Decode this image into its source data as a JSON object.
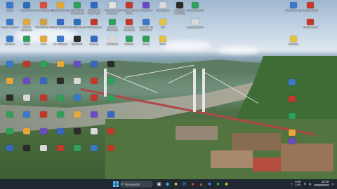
{
  "desktop": {
    "icons": [
      {
        "label": "Salvar",
        "color": "#3a78c9",
        "glyph": "folder-icon"
      },
      {
        "label": "Neyformeté",
        "color": "#2d6fb5",
        "glyph": "word-icon"
      },
      {
        "label": "Onne Scanner DI",
        "color": "#d8503c",
        "glyph": "scanner-icon"
      },
      {
        "label": "CorpsKit RoseS",
        "color": "#e4a83a",
        "glyph": "app-icon"
      },
      {
        "label": "2023 RO 2ft documentos",
        "color": "#2fa05a",
        "glyph": "folder-icon"
      },
      {
        "label": "Ativado via importação",
        "color": "#3568c0",
        "glyph": "app-icon"
      },
      {
        "label": "Winzadoraes programo",
        "color": "#e2e2e2",
        "glyph": "app-icon"
      },
      {
        "label": "PF Office-clio dei PDFs",
        "color": "#c0392b",
        "glyph": "pdf-icon"
      },
      {
        "label": "Windrafté 2",
        "color": "#6a4bc4",
        "glyph": "app-icon"
      },
      {
        "label": "PDI Arquivo",
        "color": "#d9d9d9",
        "glyph": "file-icon"
      },
      {
        "label": "Pequeño CORTES",
        "color": "#2b2b2b",
        "glyph": "app-icon"
      },
      {
        "label": "Comando BRK",
        "color": "#2fa05a",
        "glyph": "app-icon"
      },
      {
        "label": "Informe VC 1B",
        "color": "#3a78c9",
        "glyph": "app-icon"
      },
      {
        "label": "Radio CIA 20",
        "color": "#c0392b",
        "glyph": "app-icon"
      },
      {
        "label": "Gestor Outubro",
        "color": "#3a78c9",
        "glyph": "app-icon"
      },
      {
        "label": "Informe aumentos",
        "color": "#e4a83a",
        "glyph": "app-icon"
      },
      {
        "label": "TORTECAS 1B",
        "color": "#d0a040",
        "glyph": "app-icon"
      },
      {
        "label": "Ralio Acesso 2",
        "color": "#3568c0",
        "glyph": "app-icon"
      },
      {
        "label": "TC 2023 ativos",
        "color": "#2d6fb5",
        "glyph": "app-icon"
      },
      {
        "label": "ProfViewpoint",
        "color": "#c0392b",
        "glyph": "app-icon"
      },
      {
        "label": "Deveros RuntimeS",
        "color": "#2fa05a",
        "glyph": "app-icon"
      },
      {
        "label": "Consulte Solidarios",
        "color": "#c0392b",
        "glyph": "app-icon"
      },
      {
        "label": "COSAST 15 PROJETO",
        "color": "#3a78c9",
        "glyph": "app-icon"
      },
      {
        "label": "edit",
        "color": "#e4c040",
        "glyph": "folder-icon"
      },
      {
        "label": "pesquisassimo",
        "color": "#d9d9d9",
        "glyph": "file-icon"
      },
      {
        "label": "Mundo de BI",
        "color": "#c0392b",
        "glyph": "app-icon"
      },
      {
        "label": "Saldinha",
        "color": "#3a78c9",
        "glyph": "app-icon"
      },
      {
        "label": "Radio",
        "color": "#2fa05a",
        "glyph": "app-icon"
      },
      {
        "label": "Cabo",
        "color": "#e4a83a",
        "glyph": "app-icon"
      },
      {
        "label": "CF Software",
        "color": "#3a78c9",
        "glyph": "app-icon"
      },
      {
        "label": "RCORTE",
        "color": "#2b2b2b",
        "glyph": "app-icon"
      },
      {
        "label": "Informe",
        "color": "#3568c0",
        "glyph": "app-icon"
      },
      {
        "label": "Advanced",
        "color": "#d9d9d9",
        "glyph": "app-icon"
      },
      {
        "label": "Planilha",
        "color": "#2fa05a",
        "glyph": "excel-icon"
      },
      {
        "label": "Tabela",
        "color": "#2fa05a",
        "glyph": "excel-icon"
      },
      {
        "label": "Notas",
        "color": "#e4c040",
        "glyph": "folder-icon"
      },
      {
        "label": "Relatório",
        "color": "#e4c040",
        "glyph": "folder-icon"
      }
    ]
  },
  "taskbar": {
    "search_placeholder": "Busqueda",
    "lang": "ESP",
    "lang2": "LAA",
    "time": "10:19",
    "date": "20/06/2023"
  }
}
